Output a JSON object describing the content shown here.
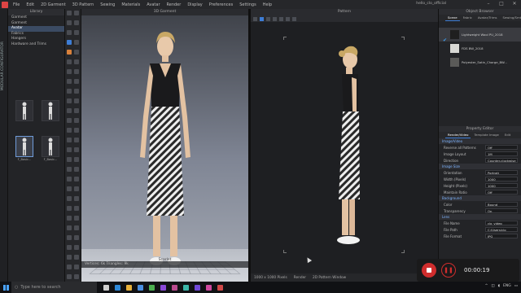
{
  "menu": {
    "items": [
      "File",
      "Edit",
      "2D Garment",
      "3D Pattern",
      "Sewing",
      "Materials",
      "Avatar",
      "Render",
      "Display",
      "Preferences",
      "Settings",
      "Help"
    ],
    "user": "hello_clo_official"
  },
  "sidebar": {
    "vertical_label": "MODULAR CONFIGURATOR"
  },
  "library": {
    "title": "Library",
    "items": [
      "Garment",
      "Garment",
      "Avatar",
      "Fabrics",
      "Hangers",
      "Hardware and Trims"
    ],
    "selected_index": 2,
    "thumbs": [
      {
        "label": "",
        "selected": false
      },
      {
        "label": "",
        "selected": false
      },
      {
        "label": "F_Basic...",
        "selected": true
      },
      {
        "label": "F_Basic...",
        "selected": false
      }
    ]
  },
  "view3d": {
    "title": "3D Garment",
    "avatar_name": "Scarlet",
    "status": "Vertices: 6k  Triangles: 9k"
  },
  "view2d": {
    "title": "Pattern",
    "status_size": "1000 x 1000 Pixels",
    "status_render": "Render",
    "status_window": "2D Pattern Window"
  },
  "object_browser": {
    "title": "Object Browser",
    "tabs": [
      "Scene",
      "Fabric",
      "Avatar/Trims",
      "Sewing/Smth"
    ],
    "rows": [
      {
        "label": "Lightweight Wool PU_2018",
        "color": "#1f1f1f"
      },
      {
        "label": "FDS BW_2018",
        "color": "#d8d8d4"
      },
      {
        "label": "Polyester_Satin_Charge_BW...",
        "color": "#5a5a58"
      }
    ]
  },
  "property_editor": {
    "title": "Property Editor",
    "tabs": [
      "Render/Video",
      "Template Image",
      "Edit"
    ],
    "sections": [
      {
        "name": "Image/Video",
        "rows": [
          {
            "label": "Reverse all Patterns",
            "value": "Off"
          },
          {
            "label": "Image Layout",
            "value": "1M"
          },
          {
            "label": "Direction",
            "value": "Counter-clockwise"
          }
        ]
      },
      {
        "name": "Image Size",
        "rows": [
          {
            "label": "Orientation",
            "value": "Portrait"
          },
          {
            "label": "Width (Pixels)",
            "value": "1000"
          },
          {
            "label": "Height (Pixels)",
            "value": "1000"
          },
          {
            "label": "Maintain Ratio",
            "value": "Off"
          }
        ]
      },
      {
        "name": "Background",
        "rows": [
          {
            "label": "Color",
            "value": "Bound"
          },
          {
            "label": "Transparency",
            "value": "On"
          }
        ]
      },
      {
        "name": "Lens",
        "rows": [
          {
            "label": "File Name",
            "value": "clo_video"
          },
          {
            "label": "File Path",
            "value": "C:/Users/clo"
          },
          {
            "label": "File Format",
            "value": "JPG"
          }
        ]
      }
    ]
  },
  "recorder": {
    "timer": "00:00:19"
  },
  "taskbar": {
    "search_placeholder": "Type here to search",
    "icons": [
      {
        "name": "task-view-icon",
        "color": "#cfcfcf"
      },
      {
        "name": "edge-icon",
        "color": "#2e89d9"
      },
      {
        "name": "file-explorer-icon",
        "color": "#e8b13b"
      },
      {
        "name": "store-icon",
        "color": "#4a8ee0"
      },
      {
        "name": "chrome-icon",
        "color": "#4caf50"
      },
      {
        "name": "app-purple-icon",
        "color": "#8a48d8"
      },
      {
        "name": "clo-icon",
        "color": "#b94a8e"
      },
      {
        "name": "app-teal-icon",
        "color": "#3bb6a8"
      },
      {
        "name": "app-violet-icon",
        "color": "#7048d8"
      },
      {
        "name": "app-pink-icon",
        "color": "#d048a0"
      },
      {
        "name": "app-red-icon",
        "color": "#d04848"
      }
    ],
    "tray_time": "",
    "language": "ENG"
  }
}
